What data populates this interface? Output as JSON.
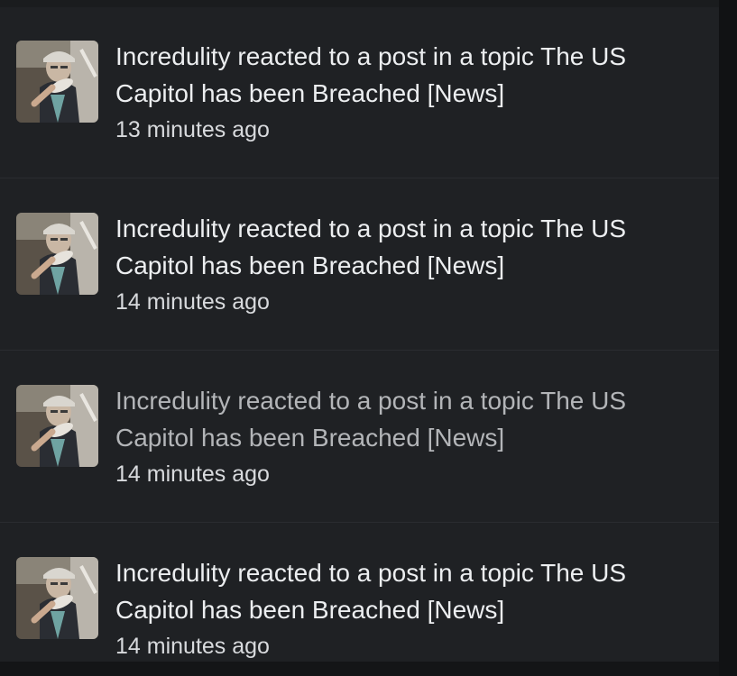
{
  "notifications": [
    {
      "text": "Incredulity reacted to a post in a topic The US Capitol has been Breached [News]",
      "time": "13 minutes ago",
      "avatar_icon": "user-avatar-icon",
      "read": false
    },
    {
      "text": "Incredulity reacted to a post in a topic The US Capitol has been Breached [News]",
      "time": "14 minutes ago",
      "avatar_icon": "user-avatar-icon",
      "read": false
    },
    {
      "text": "Incredulity reacted to a post in a topic The US Capitol has been Breached [News]",
      "time": "14 minutes ago",
      "avatar_icon": "user-avatar-icon",
      "read": true
    },
    {
      "text": "Incredulity reacted to a post in a topic The US Capitol has been Breached [News]",
      "time": "14 minutes ago",
      "avatar_icon": "user-avatar-icon",
      "read": false
    }
  ],
  "colors": {
    "background": "#1f2124",
    "text": "#eceef0",
    "muted_text": "#b3b5b8"
  }
}
